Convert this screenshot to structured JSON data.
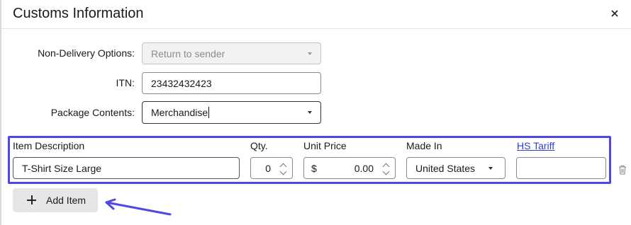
{
  "dialog": {
    "title": "Customs Information",
    "close_icon": "close-icon"
  },
  "form": {
    "non_delivery": {
      "label": "Non-Delivery Options:",
      "value": "Return to sender"
    },
    "itn": {
      "label": "ITN:",
      "value": "23432432423"
    },
    "package_contents": {
      "label": "Package Contents:",
      "value": "Merchandise"
    }
  },
  "items": {
    "headers": {
      "description": "Item Description",
      "qty": "Qty.",
      "unit_price": "Unit Price",
      "made_in": "Made In",
      "hs_tariff": "HS Tariff"
    },
    "row": {
      "description": "T-Shirt Size Large",
      "qty": "0",
      "currency": "$",
      "unit_price": "0.00",
      "made_in": "United States",
      "hs_tariff": ""
    },
    "remove_icon": "trash-icon"
  },
  "add_item": {
    "label": "Add Item"
  },
  "annotation": {
    "color": "#5046e5",
    "arrow_icon": "arrow-icon"
  }
}
